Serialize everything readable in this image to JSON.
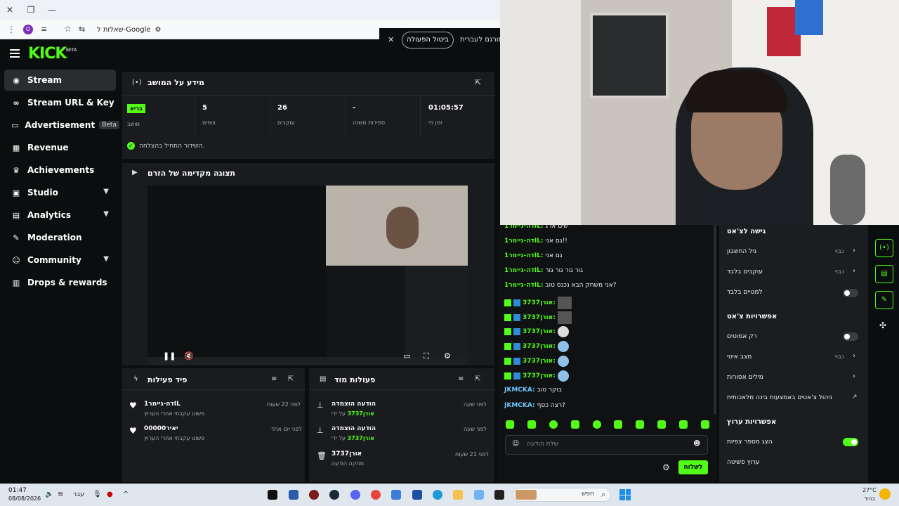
{
  "browser": {
    "address_text": "שאלות ל-Google",
    "profile_initial": "O",
    "translate_label": "תורגם לעברית",
    "undo_label": "ביטול הפעולה"
  },
  "brand": {
    "logo": "KICK",
    "beta": "BETA"
  },
  "sidebar": {
    "items": [
      {
        "label": "Stream",
        "icon": "broadcast-icon"
      },
      {
        "label": "Stream URL & Key",
        "icon": "link-icon"
      },
      {
        "label": "Advertisement",
        "icon": "ad-icon",
        "badge": "Beta"
      },
      {
        "label": "Revenue",
        "icon": "chart-icon"
      },
      {
        "label": "Achievements",
        "icon": "trophy-icon"
      },
      {
        "label": "Studio",
        "icon": "studio-icon"
      },
      {
        "label": "Analytics",
        "icon": "analytics-icon"
      },
      {
        "label": "Moderation",
        "icon": "wrench-icon"
      },
      {
        "label": "Community",
        "icon": "people-icon"
      },
      {
        "label": "Drops & rewards",
        "icon": "gift-icon"
      }
    ]
  },
  "session": {
    "title": "מידע על המושב",
    "status_badge": "בריא",
    "status_label": "מושב",
    "viewers": "5",
    "viewers_label": "צופים",
    "followers": "26",
    "followers_label": "עוקבים",
    "subs": "-",
    "subs_label": "ספירות משנה",
    "uptime": "01:05:57",
    "uptime_label": "זמן חי",
    "success_msg": "השידור התחיל בהצלחה."
  },
  "preview": {
    "title": "תצוגה מקדימה של הזרם"
  },
  "activity": {
    "title": "פיד פעילות",
    "items": [
      {
        "user": "דה-גיימר1IL",
        "desc": "פשוט עקבתי אחרי הערוץ",
        "time": "לפני 22 שעות"
      },
      {
        "user": "יאיר00000",
        "desc": "פשוט עקבתי אחרי הערוץ",
        "time": "לפני יום אחד"
      }
    ]
  },
  "mod": {
    "title": "פעולות מוד",
    "items": [
      {
        "title": "הודעה הוצמדה",
        "by": "אורן3737",
        "by_prefix": "על ידי",
        "time": "לפני שעה"
      },
      {
        "title": "הודעה הוצמדה",
        "by": "אורן3737",
        "by_prefix": "על ידי",
        "time": "לפני שעה"
      },
      {
        "title": "אורן3737",
        "by": "מחקה הודעה",
        "by_prefix": "",
        "time": "לפני 21 שעות"
      }
    ]
  },
  "chat": {
    "lines": [
      {
        "user": "דה-גיימר1IL:",
        "text": "שים או ג'"
      },
      {
        "user": "דה-גיימר1IL:",
        "text": "גם אני!!"
      },
      {
        "user": "דה-גיימר1IL:",
        "text": "גם אני"
      },
      {
        "user": "דה-גיימר1IL:",
        "text": "גור גור גור גור"
      },
      {
        "user": "דה-גיימר1IL:",
        "text": "אני משחק הבא נכנס טוב?"
      },
      {
        "user": "אורן3737:",
        "text": ""
      },
      {
        "user": "אורן3737:",
        "text": ""
      },
      {
        "user": "אורן3737:",
        "text": ""
      },
      {
        "user": "אורן3737:",
        "text": ""
      },
      {
        "user": "אורן3737:",
        "text": ""
      },
      {
        "user": "אורן3737:",
        "text": ""
      },
      {
        "user": "JKMCKA:",
        "text": "בוקר טוב"
      },
      {
        "user": "JKMCKA:",
        "text": "רצה כסף?"
      }
    ],
    "input_placeholder": "שלח הודעה",
    "send_label": "לשלוח"
  },
  "chat_settings": {
    "access_title": "גישה לצ'אט",
    "account_age": "גיל החשבון",
    "account_age_val": "כבוי",
    "followers_only": "עוקבים בלבד",
    "followers_only_val": "כבוי",
    "subs_only": "למנויים בלבד",
    "options_title": "אפשרויות צ'אט",
    "emotes_only": "רק אמוטים",
    "slow_mode": "מצב איטי",
    "slow_mode_val": "כבוי",
    "banned_words": "מילים אסורות",
    "ai_moderation": "ניהול צ'אטים באמצעות בינה מלאכותית",
    "channel_title": "אפשרויות ערוץ",
    "show_viewers": "הצג מספר צפיות",
    "simple_channel": "ערוץ פשיטה"
  },
  "taskbar": {
    "time": "01:47",
    "date": "08/08/2026",
    "lang": "עבר",
    "search": "חפש",
    "weather_temp": "27°C",
    "weather_desc": "בהיר"
  },
  "colors": {
    "accent": "#53fc18",
    "bg": "#0b0e0f",
    "panel": "#191b1f"
  }
}
